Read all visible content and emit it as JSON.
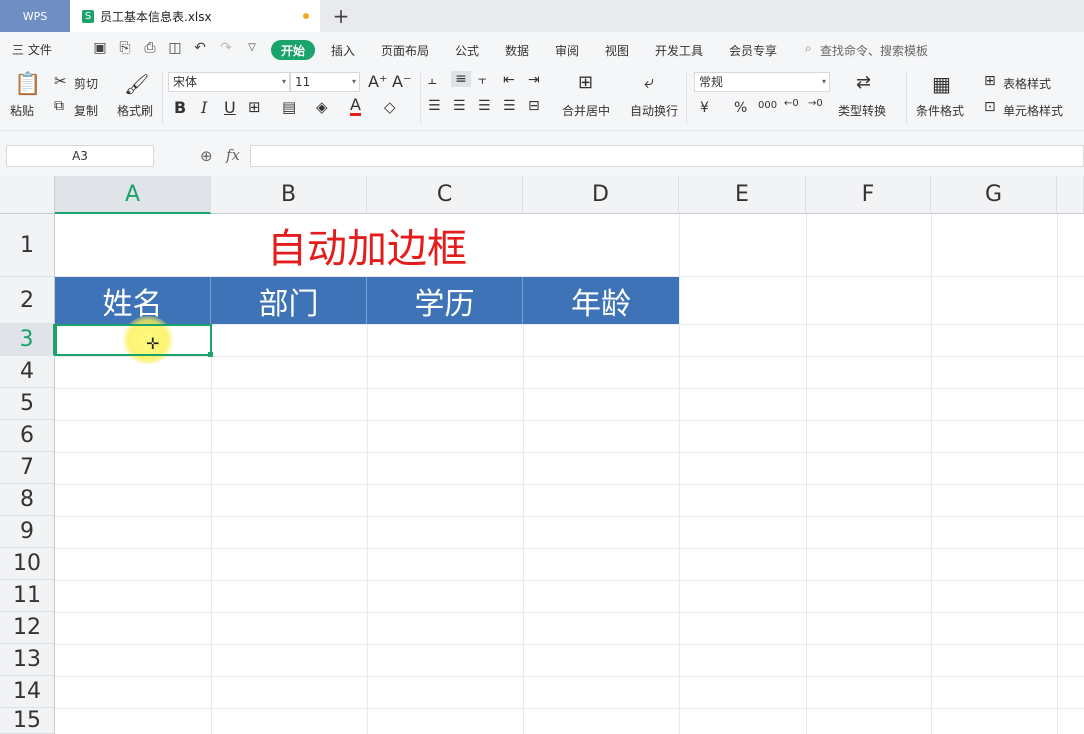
{
  "tabs": {
    "brand": "WPS",
    "file_name": "员工基本信息表.xlsx",
    "file_icon": "S",
    "new_tab": "+"
  },
  "menu": {
    "file": "三 文件",
    "items": [
      "开始",
      "插入",
      "页面布局",
      "公式",
      "数据",
      "审阅",
      "视图",
      "开发工具",
      "会员专享"
    ],
    "search_placeholder": "查找命令、搜索模板"
  },
  "ribbon": {
    "paste": "粘贴",
    "cut": "剪切",
    "copy": "复制",
    "format_painter": "格式刷",
    "font_name": "宋体",
    "font_size": "11",
    "merge_center": "合并居中",
    "wrap_text": "自动换行",
    "number_format": "常规",
    "type_convert": "类型转换",
    "conditional_format": "条件格式",
    "table_style": "表格样式",
    "cell_style": "单元格样式",
    "bold": "B",
    "italic": "I",
    "underline": "U",
    "currency": "¥",
    "percent": "%"
  },
  "formula_bar": {
    "name_box": "A3",
    "fx": "fx"
  },
  "columns": [
    "A",
    "B",
    "C",
    "D",
    "E",
    "F",
    "G"
  ],
  "rows": [
    "1",
    "2",
    "3",
    "4",
    "5",
    "6",
    "7",
    "8",
    "9",
    "10",
    "11",
    "12",
    "13",
    "14",
    "15"
  ],
  "sheet": {
    "title": "自动加边框",
    "headers": [
      "姓名",
      "部门",
      "学历",
      "年龄"
    ],
    "header_color": "#3e73b8",
    "title_color": "#e51c1c",
    "accent": "#1aa36b"
  }
}
